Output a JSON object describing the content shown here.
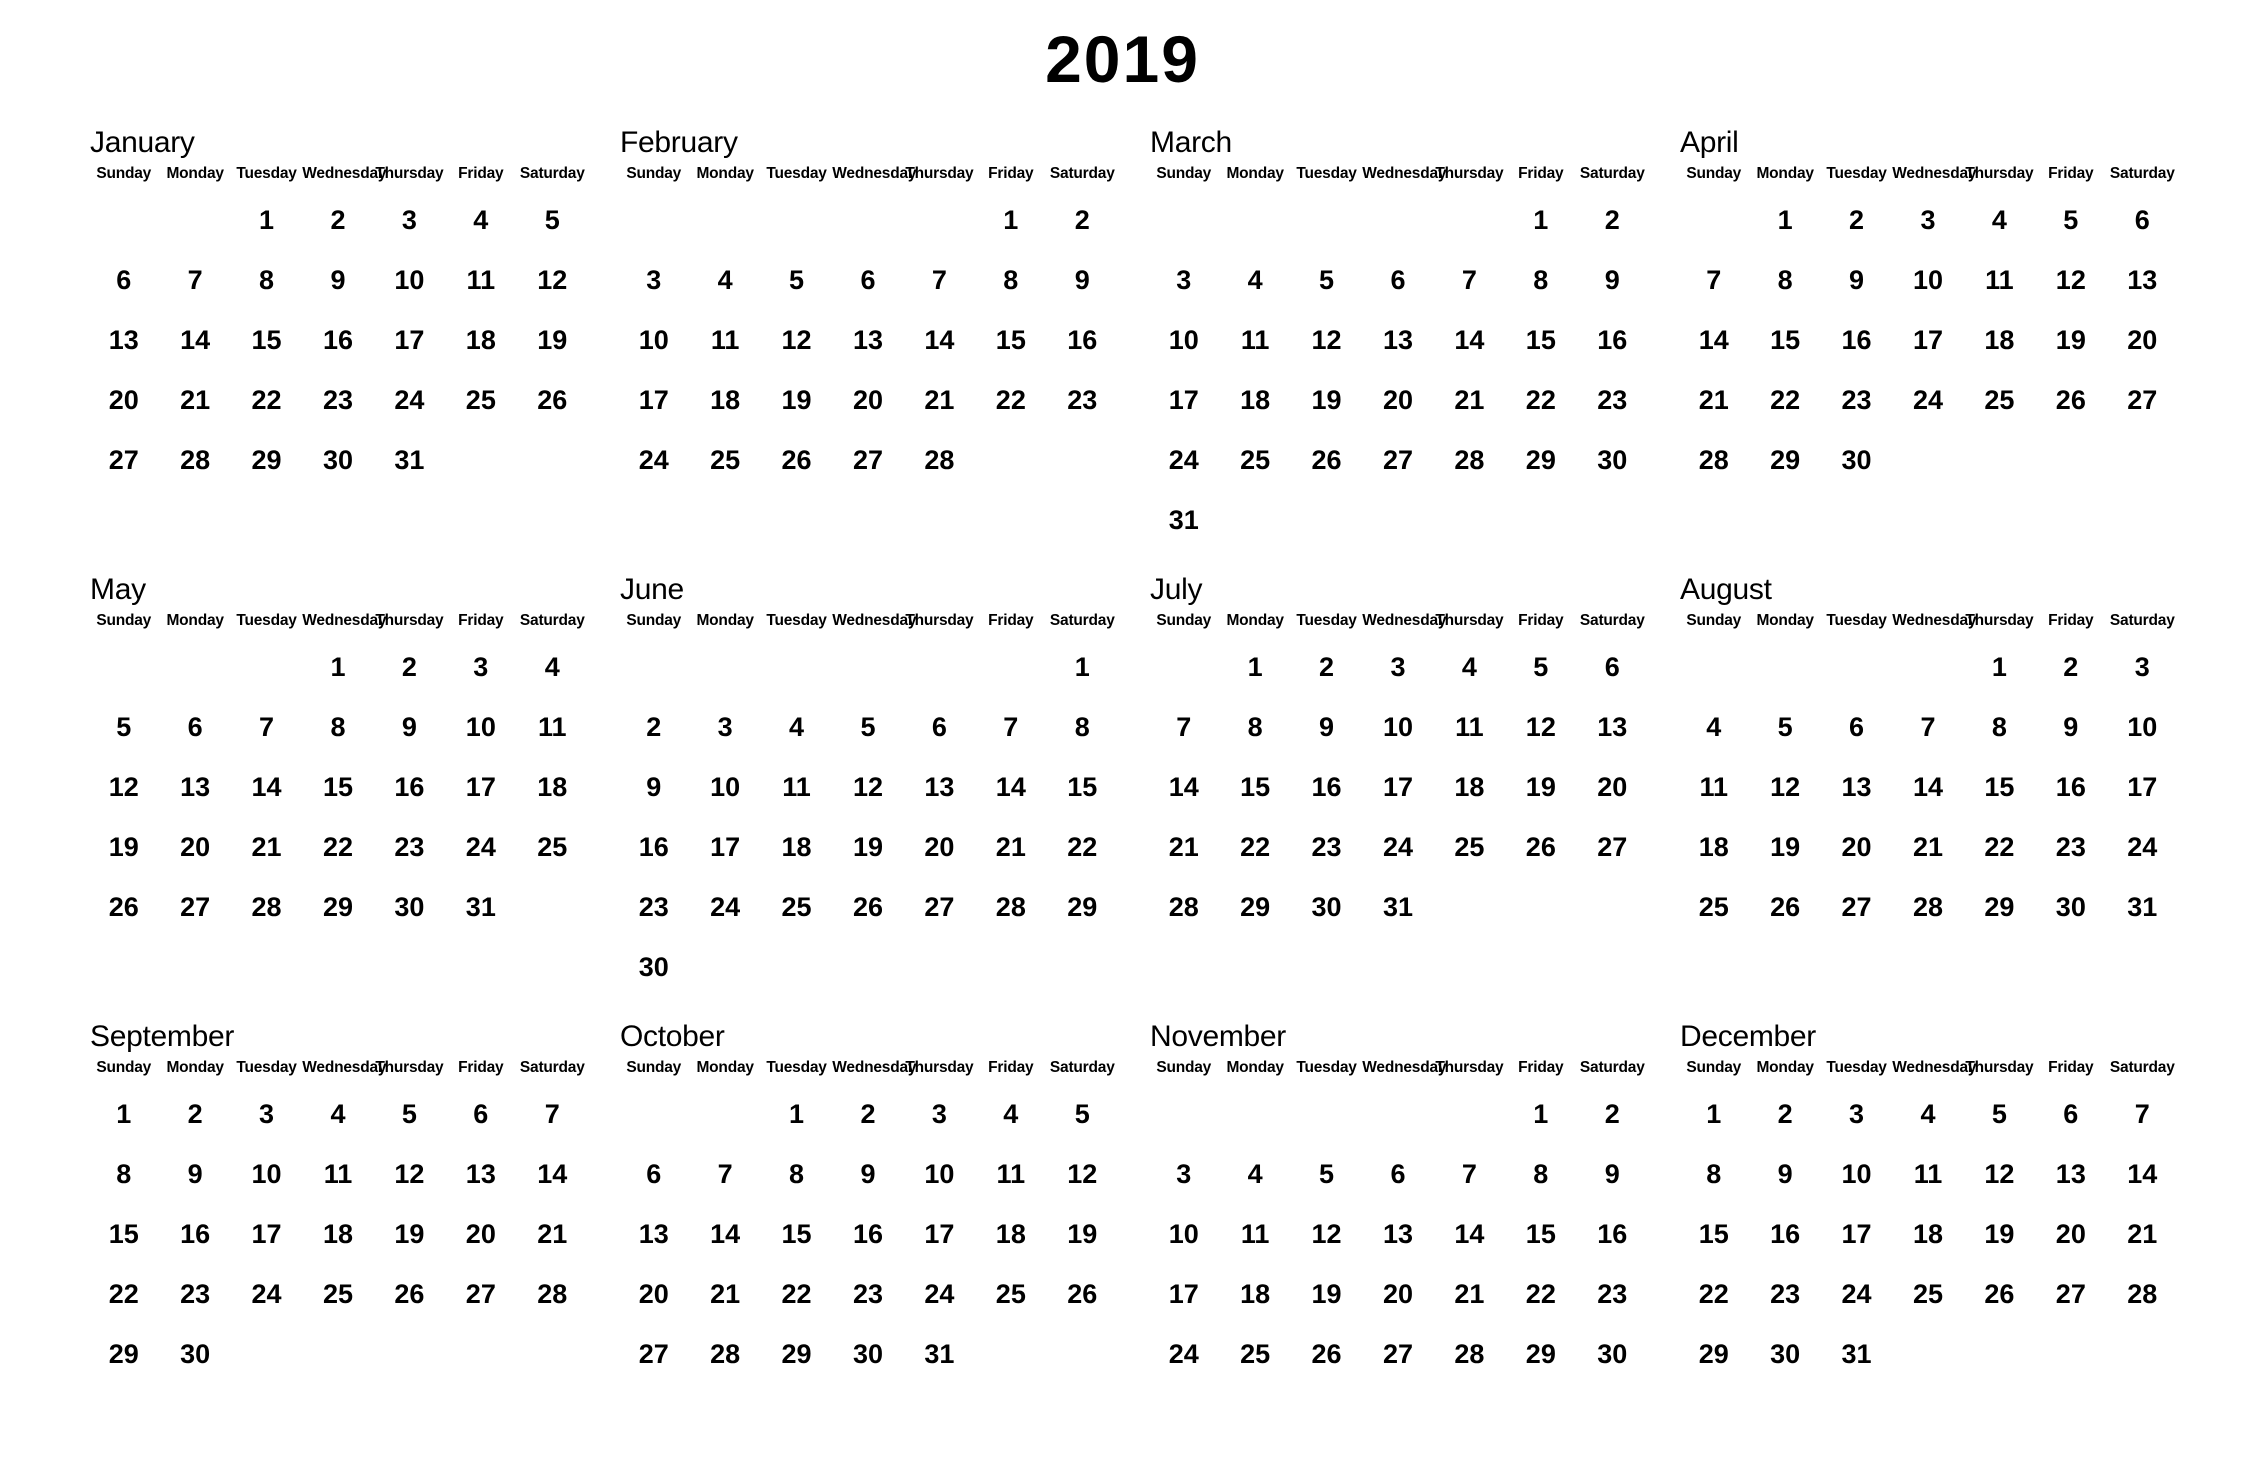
{
  "title": "2019",
  "weekdays": [
    "Sunday",
    "Monday",
    "Tuesday",
    "Wednesday",
    "Thursday",
    "Friday",
    "Saturday"
  ],
  "colors": {
    "background": "#ffffff",
    "text": "#000000"
  },
  "chart_data": {
    "type": "table",
    "title": "2019",
    "columns": [
      "Sunday",
      "Monday",
      "Tuesday",
      "Wednesday",
      "Thursday",
      "Friday",
      "Saturday"
    ],
    "layout": {
      "month_columns": 4,
      "month_rows": 3,
      "week_start": "Sunday"
    }
  },
  "months": [
    {
      "name": "January",
      "index": 1,
      "days_in_month": 31,
      "start_weekday": "Tuesday",
      "start_weekday_index": 2,
      "weeks": [
        [
          "",
          "",
          "1",
          "2",
          "3",
          "4",
          "5"
        ],
        [
          "6",
          "7",
          "8",
          "9",
          "10",
          "11",
          "12"
        ],
        [
          "13",
          "14",
          "15",
          "16",
          "17",
          "18",
          "19"
        ],
        [
          "20",
          "21",
          "22",
          "23",
          "24",
          "25",
          "26"
        ],
        [
          "27",
          "28",
          "29",
          "30",
          "31",
          "",
          ""
        ]
      ]
    },
    {
      "name": "February",
      "index": 2,
      "days_in_month": 28,
      "start_weekday": "Friday",
      "start_weekday_index": 5,
      "weeks": [
        [
          "",
          "",
          "",
          "",
          "",
          "1",
          "2"
        ],
        [
          "3",
          "4",
          "5",
          "6",
          "7",
          "8",
          "9"
        ],
        [
          "10",
          "11",
          "12",
          "13",
          "14",
          "15",
          "16"
        ],
        [
          "17",
          "18",
          "19",
          "20",
          "21",
          "22",
          "23"
        ],
        [
          "24",
          "25",
          "26",
          "27",
          "28",
          "",
          ""
        ]
      ]
    },
    {
      "name": "March",
      "index": 3,
      "days_in_month": 31,
      "start_weekday": "Friday",
      "start_weekday_index": 5,
      "weeks": [
        [
          "",
          "",
          "",
          "",
          "",
          "1",
          "2"
        ],
        [
          "3",
          "4",
          "5",
          "6",
          "7",
          "8",
          "9"
        ],
        [
          "10",
          "11",
          "12",
          "13",
          "14",
          "15",
          "16"
        ],
        [
          "17",
          "18",
          "19",
          "20",
          "21",
          "22",
          "23"
        ],
        [
          "24",
          "25",
          "26",
          "27",
          "28",
          "29",
          "30"
        ],
        [
          "31",
          "",
          "",
          "",
          "",
          "",
          ""
        ]
      ]
    },
    {
      "name": "April",
      "index": 4,
      "days_in_month": 30,
      "start_weekday": "Monday",
      "start_weekday_index": 1,
      "weeks": [
        [
          "",
          "1",
          "2",
          "3",
          "4",
          "5",
          "6"
        ],
        [
          "7",
          "8",
          "9",
          "10",
          "11",
          "12",
          "13"
        ],
        [
          "14",
          "15",
          "16",
          "17",
          "18",
          "19",
          "20"
        ],
        [
          "21",
          "22",
          "23",
          "24",
          "25",
          "26",
          "27"
        ],
        [
          "28",
          "29",
          "30",
          "",
          "",
          "",
          ""
        ]
      ]
    },
    {
      "name": "May",
      "index": 5,
      "days_in_month": 31,
      "start_weekday": "Wednesday",
      "start_weekday_index": 3,
      "weeks": [
        [
          "",
          "",
          "",
          "1",
          "2",
          "3",
          "4"
        ],
        [
          "5",
          "6",
          "7",
          "8",
          "9",
          "10",
          "11"
        ],
        [
          "12",
          "13",
          "14",
          "15",
          "16",
          "17",
          "18"
        ],
        [
          "19",
          "20",
          "21",
          "22",
          "23",
          "24",
          "25"
        ],
        [
          "26",
          "27",
          "28",
          "29",
          "30",
          "31",
          ""
        ]
      ]
    },
    {
      "name": "June",
      "index": 6,
      "days_in_month": 30,
      "start_weekday": "Saturday",
      "start_weekday_index": 6,
      "weeks": [
        [
          "",
          "",
          "",
          "",
          "",
          "",
          "1"
        ],
        [
          "2",
          "3",
          "4",
          "5",
          "6",
          "7",
          "8"
        ],
        [
          "9",
          "10",
          "11",
          "12",
          "13",
          "14",
          "15"
        ],
        [
          "16",
          "17",
          "18",
          "19",
          "20",
          "21",
          "22"
        ],
        [
          "23",
          "24",
          "25",
          "26",
          "27",
          "28",
          "29"
        ],
        [
          "30",
          "",
          "",
          "",
          "",
          "",
          ""
        ]
      ]
    },
    {
      "name": "July",
      "index": 7,
      "days_in_month": 31,
      "start_weekday": "Monday",
      "start_weekday_index": 1,
      "weeks": [
        [
          "",
          "1",
          "2",
          "3",
          "4",
          "5",
          "6"
        ],
        [
          "7",
          "8",
          "9",
          "10",
          "11",
          "12",
          "13"
        ],
        [
          "14",
          "15",
          "16",
          "17",
          "18",
          "19",
          "20"
        ],
        [
          "21",
          "22",
          "23",
          "24",
          "25",
          "26",
          "27"
        ],
        [
          "28",
          "29",
          "30",
          "31",
          "",
          "",
          ""
        ]
      ]
    },
    {
      "name": "August",
      "index": 8,
      "days_in_month": 31,
      "start_weekday": "Thursday",
      "start_weekday_index": 4,
      "weeks": [
        [
          "",
          "",
          "",
          "",
          "1",
          "2",
          "3"
        ],
        [
          "4",
          "5",
          "6",
          "7",
          "8",
          "9",
          "10"
        ],
        [
          "11",
          "12",
          "13",
          "14",
          "15",
          "16",
          "17"
        ],
        [
          "18",
          "19",
          "20",
          "21",
          "22",
          "23",
          "24"
        ],
        [
          "25",
          "26",
          "27",
          "28",
          "29",
          "30",
          "31"
        ]
      ]
    },
    {
      "name": "September",
      "index": 9,
      "days_in_month": 30,
      "start_weekday": "Sunday",
      "start_weekday_index": 0,
      "weeks": [
        [
          "1",
          "2",
          "3",
          "4",
          "5",
          "6",
          "7"
        ],
        [
          "8",
          "9",
          "10",
          "11",
          "12",
          "13",
          "14"
        ],
        [
          "15",
          "16",
          "17",
          "18",
          "19",
          "20",
          "21"
        ],
        [
          "22",
          "23",
          "24",
          "25",
          "26",
          "27",
          "28"
        ],
        [
          "29",
          "30",
          "",
          "",
          "",
          "",
          ""
        ]
      ]
    },
    {
      "name": "October",
      "index": 10,
      "days_in_month": 31,
      "start_weekday": "Tuesday",
      "start_weekday_index": 2,
      "weeks": [
        [
          "",
          "",
          "1",
          "2",
          "3",
          "4",
          "5"
        ],
        [
          "6",
          "7",
          "8",
          "9",
          "10",
          "11",
          "12"
        ],
        [
          "13",
          "14",
          "15",
          "16",
          "17",
          "18",
          "19"
        ],
        [
          "20",
          "21",
          "22",
          "23",
          "24",
          "25",
          "26"
        ],
        [
          "27",
          "28",
          "29",
          "30",
          "31",
          "",
          ""
        ]
      ]
    },
    {
      "name": "November",
      "index": 11,
      "days_in_month": 30,
      "start_weekday": "Friday",
      "start_weekday_index": 5,
      "weeks": [
        [
          "",
          "",
          "",
          "",
          "",
          "1",
          "2"
        ],
        [
          "3",
          "4",
          "5",
          "6",
          "7",
          "8",
          "9"
        ],
        [
          "10",
          "11",
          "12",
          "13",
          "14",
          "15",
          "16"
        ],
        [
          "17",
          "18",
          "19",
          "20",
          "21",
          "22",
          "23"
        ],
        [
          "24",
          "25",
          "26",
          "27",
          "28",
          "29",
          "30"
        ]
      ]
    },
    {
      "name": "December",
      "index": 12,
      "days_in_month": 31,
      "start_weekday": "Sunday",
      "start_weekday_index": 0,
      "weeks": [
        [
          "1",
          "2",
          "3",
          "4",
          "5",
          "6",
          "7"
        ],
        [
          "8",
          "9",
          "10",
          "11",
          "12",
          "13",
          "14"
        ],
        [
          "15",
          "16",
          "17",
          "18",
          "19",
          "20",
          "21"
        ],
        [
          "22",
          "23",
          "24",
          "25",
          "26",
          "27",
          "28"
        ],
        [
          "29",
          "30",
          "31",
          "",
          "",
          "",
          ""
        ]
      ]
    }
  ]
}
